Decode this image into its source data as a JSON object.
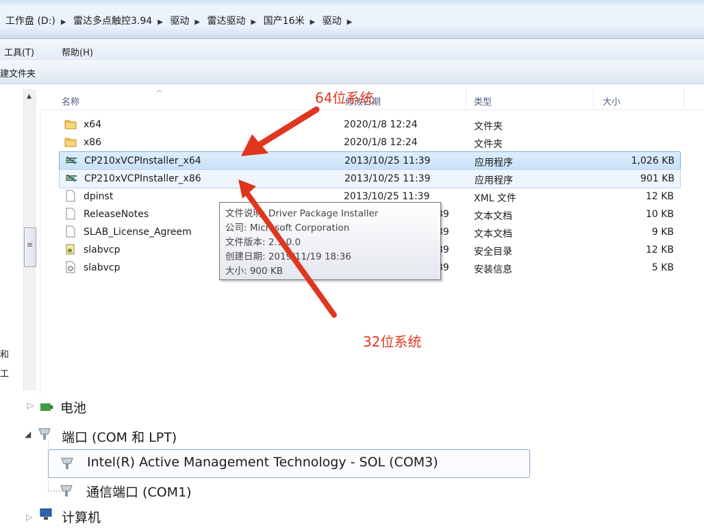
{
  "explorer": {
    "breadcrumb": [
      "工作盘 (D:)",
      "雷达多点触控3.94",
      "驱动",
      "雷达驱动",
      "国产16米",
      "驱动"
    ],
    "menu": {
      "tools": "工具(T)",
      "help": "帮助(H)"
    },
    "toolbar": {
      "new_folder": "建文件夹"
    },
    "columns": {
      "name": "名称",
      "date": "修改日期",
      "type": "类型",
      "size": "大小"
    },
    "files": [
      {
        "name": "x64",
        "date": "2020/1/8 12:24",
        "type": "文件夹",
        "size": "",
        "icon": "folder-icon"
      },
      {
        "name": "x86",
        "date": "2020/1/8 12:24",
        "type": "文件夹",
        "size": "",
        "icon": "folder-icon"
      },
      {
        "name": "CP210xVCPInstaller_x64",
        "date": "2013/10/25 11:39",
        "type": "应用程序",
        "size": "1,026 KB",
        "icon": "installer-icon"
      },
      {
        "name": "CP210xVCPInstaller_x86",
        "date": "2013/10/25 11:39",
        "type": "应用程序",
        "size": "901 KB",
        "icon": "installer-icon"
      },
      {
        "name": "dpinst",
        "date": "2013/10/25 11:39",
        "type": "XML 文件",
        "size": "12 KB",
        "icon": "document-icon"
      },
      {
        "name": "ReleaseNotes",
        "date": "39",
        "type": "文本文档",
        "size": "10 KB",
        "icon": "document-icon"
      },
      {
        "name": "SLAB_License_Agreem",
        "date": "39",
        "type": "文本文档",
        "size": "9 KB",
        "icon": "document-icon"
      },
      {
        "name": "slabvcp",
        "date": "39",
        "type": "安全目录",
        "size": "12 KB",
        "icon": "catalog-icon"
      },
      {
        "name": "slabvcp",
        "date": "39",
        "type": "安装信息",
        "size": "5 KB",
        "icon": "setup-info-icon"
      }
    ],
    "tooltip": [
      "文件说明: Driver Package Installer",
      "公司: Microsoft Corporation",
      "文件版本: 2.1.0.0",
      "创建日期: 2019/11/19 18:36",
      "大小: 900 KB"
    ],
    "nav_fragments": [
      "和",
      "工"
    ]
  },
  "annotations": {
    "label_64": "64位系统",
    "label_32": "32位系统",
    "color": "#e0361f"
  },
  "device_manager": {
    "partial_item": "电池",
    "ports_group": "端口 (COM 和 LPT)",
    "devices": [
      "Intel(R) Active Management Technology - SOL (COM3)",
      "通信端口 (COM1)"
    ],
    "next_group": "计算机"
  }
}
